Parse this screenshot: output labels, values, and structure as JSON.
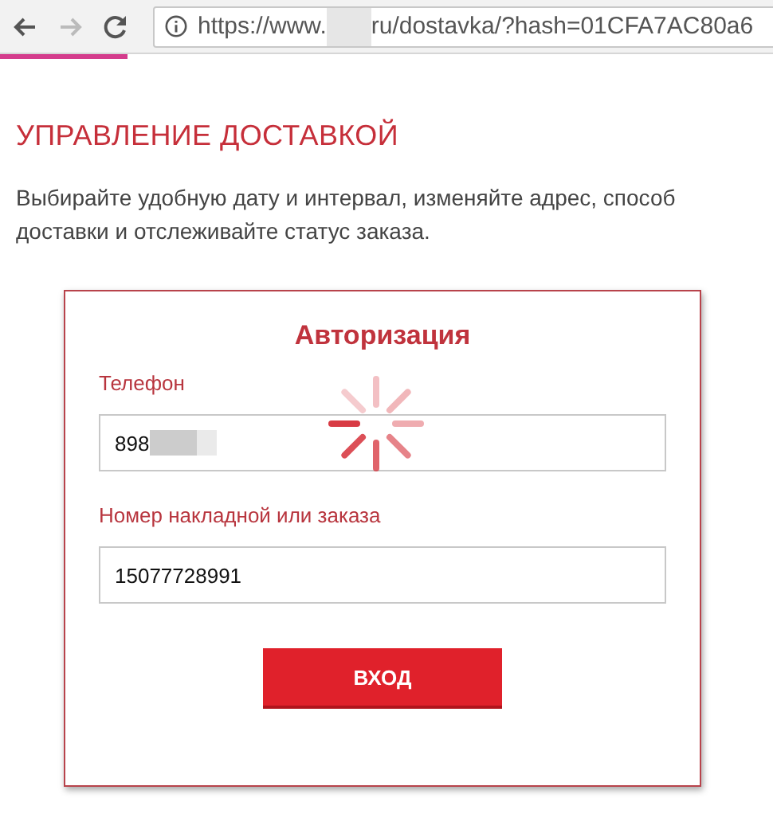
{
  "browser": {
    "url_start": "https://www.",
    "url_end": "ru/dostavka/?hash=01CFA7AC80a6",
    "loading": true
  },
  "heading": "УПРАВЛЕНИЕ ДОСТАВКОЙ",
  "description": "Выбирайте удобную дату и интервал, изменяйте адрес, способ доставки и отслеживайте статус заказа.",
  "form": {
    "title": "Авторизация",
    "loading": true,
    "fields": [
      {
        "label": "Телефон",
        "value": "898",
        "masked": true
      },
      {
        "label": "Номер накладной или заказа",
        "value": "15077728991",
        "masked": false
      }
    ],
    "button": "ВХОД"
  }
}
